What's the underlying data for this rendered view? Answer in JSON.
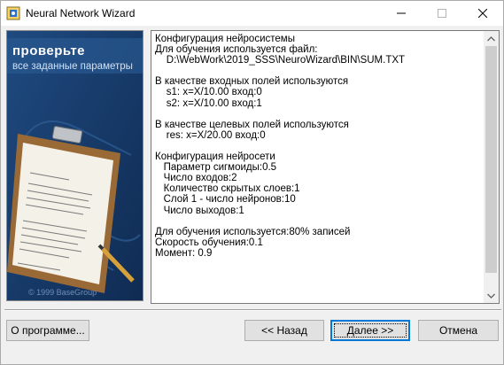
{
  "window": {
    "title": "Neural Network Wizard"
  },
  "banner": {
    "heading": "проверьте",
    "subheading": "все заданные параметры",
    "copyright": "© 1999 BaseGroup",
    "colors": {
      "background": "#173b69",
      "heading": "#ffffff"
    }
  },
  "summary": {
    "text": "Конфигурация нейросистемы\nДля обучения используется файл:\n    D:\\WebWork\\2019_SSS\\NeuroWizard\\BIN\\SUM.TXT\n\nВ качестве входных полей используются\n    s1: x=X/10.00 вход:0\n    s2: x=X/10.00 вход:1\n\nВ качестве целевых полей используются\n    res: x=X/20.00 вход:0\n\nКонфигурация нейросети\n   Параметр сигмоиды:0.5\n   Число входов:2\n   Количество скрытых слоев:1\n   Слой 1 - число нейронов:10\n   Число выходов:1\n\nДля обучения используется:80% записей\nСкорость обучения:0.1\nМомент: 0.9"
  },
  "buttons": {
    "about": "О программе...",
    "back": "<< Назад",
    "next": "Далее >>",
    "cancel": "Отмена"
  },
  "icons": {
    "app": "app-icon",
    "minimize": "minimize-icon",
    "maximize": "maximize-icon",
    "close": "close-icon",
    "scroll_up": "chevron-up-icon",
    "scroll_down": "chevron-down-icon"
  },
  "colors": {
    "accent": "#0078d7",
    "window_bg": "#f0f0f0"
  }
}
